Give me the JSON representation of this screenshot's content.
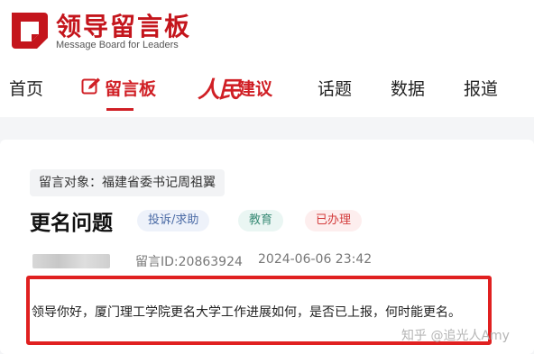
{
  "brand": {
    "title": "领导留言板",
    "subtitle": "Message Board for Leaders",
    "color": "#c4151c"
  },
  "nav": {
    "items": [
      {
        "label": "首页",
        "active": false
      },
      {
        "label": "留言板",
        "active": true
      },
      {
        "label_part1": "人民",
        "label_part2": "建议",
        "active": false
      },
      {
        "label": "话题",
        "active": false
      },
      {
        "label": "数据",
        "active": false
      },
      {
        "label": "报道",
        "active": false
      }
    ],
    "accent": "#d01f25"
  },
  "message": {
    "target": "留言对象：福建省委书记周祖翼",
    "title": "更名问题",
    "tags": {
      "type": "投诉/求助",
      "domain": "教育",
      "status": "已办理"
    },
    "id_text": "留言ID:20863924",
    "time": "2024-06-06 23:42",
    "content": "领导你好，厦门理工学院更名大学工作进展如何，是否已上报，何时能更名。"
  },
  "watermark": "知乎 @追光人Amy",
  "icons": {
    "logo": "message-board-logo-icon",
    "edit": "edit-pen-icon"
  }
}
